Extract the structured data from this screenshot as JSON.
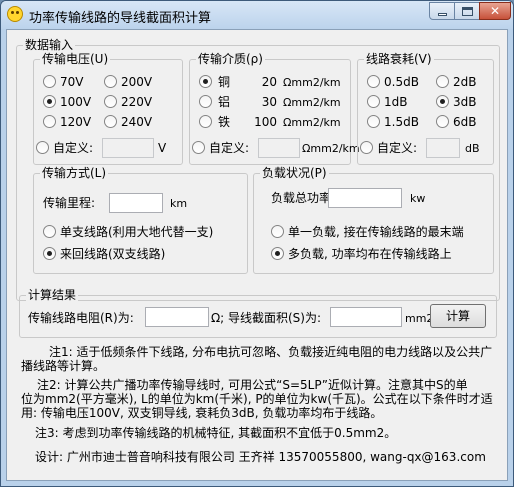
{
  "window": {
    "title": "功率传输线路的导线截面积计算"
  },
  "data_input": {
    "title": "数据输入",
    "voltage": {
      "title": "传输电压(U)",
      "options": [
        {
          "label": "70V",
          "selected": false
        },
        {
          "label": "200V",
          "selected": false
        },
        {
          "label": "100V",
          "selected": true
        },
        {
          "label": "220V",
          "selected": false
        },
        {
          "label": "120V",
          "selected": false
        },
        {
          "label": "240V",
          "selected": false
        }
      ],
      "custom_label": "自定义:",
      "custom_value": "",
      "unit": "V"
    },
    "medium": {
      "title": "传输介质(ρ)",
      "options": [
        {
          "name": "铜",
          "value": "20",
          "unit": "Ωmm2/km",
          "selected": true
        },
        {
          "name": "铝",
          "value": "30",
          "unit": "Ωmm2/km",
          "selected": false
        },
        {
          "name": "铁",
          "value": "100",
          "unit": "Ωmm2/km",
          "selected": false
        }
      ],
      "custom_label": "自定义:",
      "custom_value": "",
      "unit": "Ωmm2/km"
    },
    "attenuation": {
      "title": "线路衰耗(V)",
      "options": [
        {
          "label": "0.5dB",
          "selected": false
        },
        {
          "label": "2dB",
          "selected": false
        },
        {
          "label": "1dB",
          "selected": false
        },
        {
          "label": "3dB",
          "selected": true
        },
        {
          "label": "1.5dB",
          "selected": false
        },
        {
          "label": "6dB",
          "selected": false
        }
      ],
      "custom_label": "自定义:",
      "custom_value": "",
      "unit": "dB"
    },
    "method": {
      "title": "传输方式(L)",
      "distance_label": "传输里程:",
      "distance_value": "",
      "distance_unit": "km",
      "options": [
        {
          "label": "单支线路(利用大地代替一支)",
          "selected": false
        },
        {
          "label": "来回线路(双支线路)",
          "selected": true
        }
      ]
    },
    "load": {
      "title": "负载状况(P)",
      "power_label": "负载总功率:",
      "power_value": "",
      "power_unit": "kw",
      "options": [
        {
          "label": "单一负载, 接在传输线路的最末端",
          "selected": false
        },
        {
          "label": "多负载, 功率均布在传输线路上",
          "selected": true
        }
      ]
    }
  },
  "results": {
    "title": "计算结果",
    "resistance_label": "传输线路电阻(R)为:",
    "resistance_value": "",
    "resistance_unit": "Ω;",
    "area_label": "导线截面积(S)为:",
    "area_value": "",
    "area_unit": "mm2",
    "calc_button": "计算"
  },
  "notes": {
    "note1_line1": "注1: 适于低频条件下线路, 分布电抗可忽略、负载接近纯电阻的电力线路以及公共广",
    "note1_line2": "播线路等计算。",
    "note2_line1": "注2: 计算公共广播功率传输导线时, 可用公式“S=5LP”近似计算。注意其中S的单",
    "note2_line2": "位为mm2(平方毫米), L的单位为km(千米), P的单位为kw(千瓦)。公式在以下条件时才适",
    "note2_line3": "用: 传输电压100V, 双支铜导线, 衰耗负3dB, 负载功率均布于线路。",
    "note3": "注3: 考虑到功率传输线路的机械特征, 其截面积不宜低于0.5mm2。",
    "designer": "设计: 广州市迪士普音响科技有限公司 王齐祥 13570055800, wang-qx@163.com"
  }
}
